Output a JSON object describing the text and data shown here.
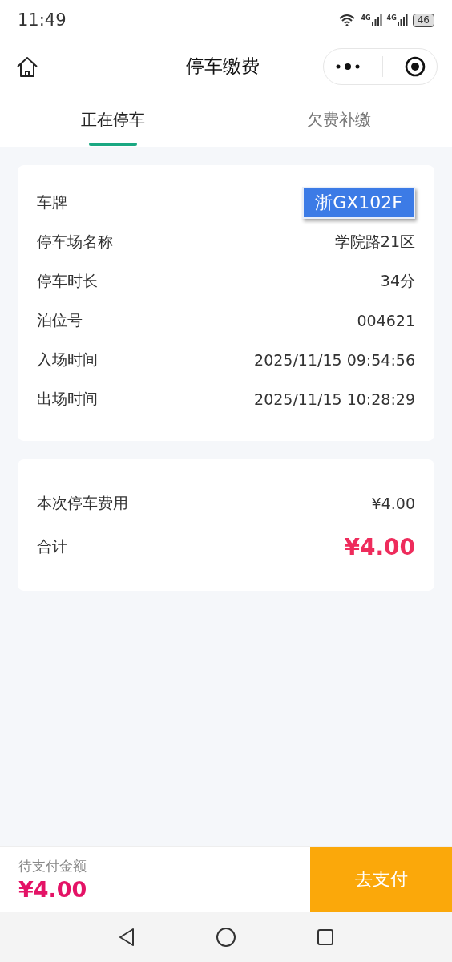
{
  "status_bar": {
    "time": "11:49",
    "networks": [
      "4G",
      "4G"
    ],
    "battery": "46"
  },
  "header": {
    "title": "停车缴费"
  },
  "tabs": [
    {
      "label": "正在停车",
      "selected": true
    },
    {
      "label": "欠费补缴",
      "selected": false
    }
  ],
  "details": [
    {
      "label": "车牌",
      "value": "浙GX102F",
      "kind": "plate"
    },
    {
      "label": "停车场名称",
      "value": "学院路21区",
      "kind": "text"
    },
    {
      "label": "停车时长",
      "value": "34分",
      "kind": "text"
    },
    {
      "label": "泊位号",
      "value": "004621",
      "kind": "text"
    },
    {
      "label": "入场时间",
      "value": "2025/11/15 09:54:56",
      "kind": "text"
    },
    {
      "label": "出场时间",
      "value": "2025/11/15 10:28:29",
      "kind": "text"
    }
  ],
  "fees": [
    {
      "label": "本次停车费用",
      "value": "¥4.00",
      "kind": "normal"
    },
    {
      "label": "合计",
      "value": "¥4.00",
      "kind": "total"
    }
  ],
  "pay_bar": {
    "label": "待支付金额",
    "amount": "¥4.00",
    "button": "去支付"
  }
}
